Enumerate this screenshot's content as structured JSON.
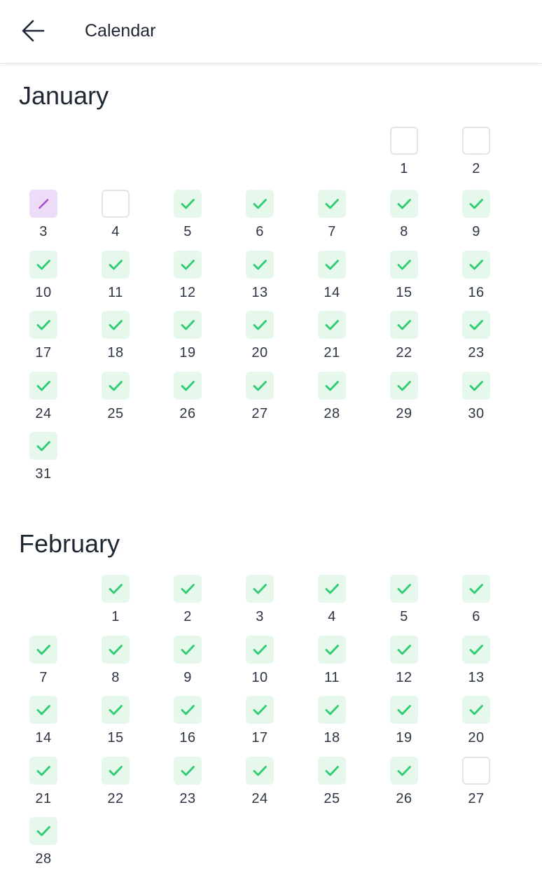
{
  "header": {
    "title": "Calendar",
    "back_icon": "arrow-left-icon"
  },
  "colors": {
    "done": "#2ecc71",
    "done_bg": "#e6f8ec",
    "progress": "#a64dcc",
    "progress_bg": "#ecdcf7",
    "empty_border": "#e2e4e8"
  },
  "months": [
    {
      "name": "January",
      "days": [
        {
          "num": "1",
          "status": "empty"
        },
        {
          "num": "2",
          "status": "empty"
        },
        {
          "num": "3",
          "status": "progress"
        },
        {
          "num": "4",
          "status": "empty"
        },
        {
          "num": "5",
          "status": "done"
        },
        {
          "num": "6",
          "status": "done"
        },
        {
          "num": "7",
          "status": "done"
        },
        {
          "num": "8",
          "status": "done"
        },
        {
          "num": "9",
          "status": "done"
        },
        {
          "num": "10",
          "status": "done"
        },
        {
          "num": "11",
          "status": "done"
        },
        {
          "num": "12",
          "status": "done"
        },
        {
          "num": "13",
          "status": "done"
        },
        {
          "num": "14",
          "status": "done"
        },
        {
          "num": "15",
          "status": "done"
        },
        {
          "num": "16",
          "status": "done"
        },
        {
          "num": "17",
          "status": "done"
        },
        {
          "num": "18",
          "status": "done"
        },
        {
          "num": "19",
          "status": "done"
        },
        {
          "num": "20",
          "status": "done"
        },
        {
          "num": "21",
          "status": "done"
        },
        {
          "num": "22",
          "status": "done"
        },
        {
          "num": "23",
          "status": "done"
        },
        {
          "num": "24",
          "status": "done"
        },
        {
          "num": "25",
          "status": "done"
        },
        {
          "num": "26",
          "status": "done"
        },
        {
          "num": "27",
          "status": "done"
        },
        {
          "num": "28",
          "status": "done"
        },
        {
          "num": "29",
          "status": "done"
        },
        {
          "num": "30",
          "status": "done"
        },
        {
          "num": "31",
          "status": "done"
        }
      ]
    },
    {
      "name": "February",
      "days": [
        {
          "num": "1",
          "status": "done"
        },
        {
          "num": "2",
          "status": "done"
        },
        {
          "num": "3",
          "status": "done"
        },
        {
          "num": "4",
          "status": "done"
        },
        {
          "num": "5",
          "status": "done"
        },
        {
          "num": "6",
          "status": "done"
        },
        {
          "num": "7",
          "status": "done"
        },
        {
          "num": "8",
          "status": "done"
        },
        {
          "num": "9",
          "status": "done"
        },
        {
          "num": "10",
          "status": "done"
        },
        {
          "num": "11",
          "status": "done"
        },
        {
          "num": "12",
          "status": "done"
        },
        {
          "num": "13",
          "status": "done"
        },
        {
          "num": "14",
          "status": "done"
        },
        {
          "num": "15",
          "status": "done"
        },
        {
          "num": "16",
          "status": "done"
        },
        {
          "num": "17",
          "status": "done"
        },
        {
          "num": "18",
          "status": "done"
        },
        {
          "num": "19",
          "status": "done"
        },
        {
          "num": "20",
          "status": "done"
        },
        {
          "num": "21",
          "status": "done"
        },
        {
          "num": "22",
          "status": "done"
        },
        {
          "num": "23",
          "status": "done"
        },
        {
          "num": "24",
          "status": "done"
        },
        {
          "num": "25",
          "status": "done"
        },
        {
          "num": "26",
          "status": "done"
        },
        {
          "num": "27",
          "status": "empty"
        },
        {
          "num": "28",
          "status": "done"
        }
      ]
    }
  ]
}
